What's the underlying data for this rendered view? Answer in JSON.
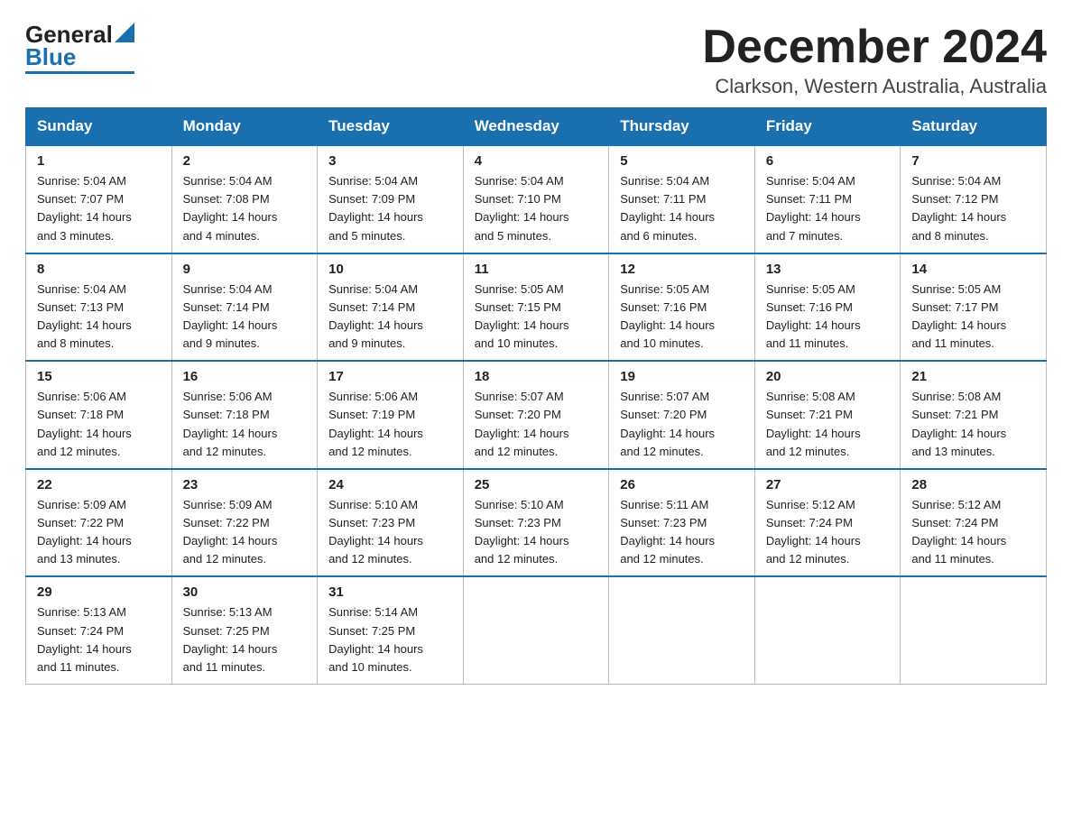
{
  "header": {
    "logo_general": "General",
    "logo_blue": "Blue",
    "month_title": "December 2024",
    "location": "Clarkson, Western Australia, Australia"
  },
  "days_of_week": [
    "Sunday",
    "Monday",
    "Tuesday",
    "Wednesday",
    "Thursday",
    "Friday",
    "Saturday"
  ],
  "weeks": [
    [
      {
        "day": "1",
        "sunrise": "5:04 AM",
        "sunset": "7:07 PM",
        "daylight": "14 hours and 3 minutes."
      },
      {
        "day": "2",
        "sunrise": "5:04 AM",
        "sunset": "7:08 PM",
        "daylight": "14 hours and 4 minutes."
      },
      {
        "day": "3",
        "sunrise": "5:04 AM",
        "sunset": "7:09 PM",
        "daylight": "14 hours and 5 minutes."
      },
      {
        "day": "4",
        "sunrise": "5:04 AM",
        "sunset": "7:10 PM",
        "daylight": "14 hours and 5 minutes."
      },
      {
        "day": "5",
        "sunrise": "5:04 AM",
        "sunset": "7:11 PM",
        "daylight": "14 hours and 6 minutes."
      },
      {
        "day": "6",
        "sunrise": "5:04 AM",
        "sunset": "7:11 PM",
        "daylight": "14 hours and 7 minutes."
      },
      {
        "day": "7",
        "sunrise": "5:04 AM",
        "sunset": "7:12 PM",
        "daylight": "14 hours and 8 minutes."
      }
    ],
    [
      {
        "day": "8",
        "sunrise": "5:04 AM",
        "sunset": "7:13 PM",
        "daylight": "14 hours and 8 minutes."
      },
      {
        "day": "9",
        "sunrise": "5:04 AM",
        "sunset": "7:14 PM",
        "daylight": "14 hours and 9 minutes."
      },
      {
        "day": "10",
        "sunrise": "5:04 AM",
        "sunset": "7:14 PM",
        "daylight": "14 hours and 9 minutes."
      },
      {
        "day": "11",
        "sunrise": "5:05 AM",
        "sunset": "7:15 PM",
        "daylight": "14 hours and 10 minutes."
      },
      {
        "day": "12",
        "sunrise": "5:05 AM",
        "sunset": "7:16 PM",
        "daylight": "14 hours and 10 minutes."
      },
      {
        "day": "13",
        "sunrise": "5:05 AM",
        "sunset": "7:16 PM",
        "daylight": "14 hours and 11 minutes."
      },
      {
        "day": "14",
        "sunrise": "5:05 AM",
        "sunset": "7:17 PM",
        "daylight": "14 hours and 11 minutes."
      }
    ],
    [
      {
        "day": "15",
        "sunrise": "5:06 AM",
        "sunset": "7:18 PM",
        "daylight": "14 hours and 12 minutes."
      },
      {
        "day": "16",
        "sunrise": "5:06 AM",
        "sunset": "7:18 PM",
        "daylight": "14 hours and 12 minutes."
      },
      {
        "day": "17",
        "sunrise": "5:06 AM",
        "sunset": "7:19 PM",
        "daylight": "14 hours and 12 minutes."
      },
      {
        "day": "18",
        "sunrise": "5:07 AM",
        "sunset": "7:20 PM",
        "daylight": "14 hours and 12 minutes."
      },
      {
        "day": "19",
        "sunrise": "5:07 AM",
        "sunset": "7:20 PM",
        "daylight": "14 hours and 12 minutes."
      },
      {
        "day": "20",
        "sunrise": "5:08 AM",
        "sunset": "7:21 PM",
        "daylight": "14 hours and 12 minutes."
      },
      {
        "day": "21",
        "sunrise": "5:08 AM",
        "sunset": "7:21 PM",
        "daylight": "14 hours and 13 minutes."
      }
    ],
    [
      {
        "day": "22",
        "sunrise": "5:09 AM",
        "sunset": "7:22 PM",
        "daylight": "14 hours and 13 minutes."
      },
      {
        "day": "23",
        "sunrise": "5:09 AM",
        "sunset": "7:22 PM",
        "daylight": "14 hours and 12 minutes."
      },
      {
        "day": "24",
        "sunrise": "5:10 AM",
        "sunset": "7:23 PM",
        "daylight": "14 hours and 12 minutes."
      },
      {
        "day": "25",
        "sunrise": "5:10 AM",
        "sunset": "7:23 PM",
        "daylight": "14 hours and 12 minutes."
      },
      {
        "day": "26",
        "sunrise": "5:11 AM",
        "sunset": "7:23 PM",
        "daylight": "14 hours and 12 minutes."
      },
      {
        "day": "27",
        "sunrise": "5:12 AM",
        "sunset": "7:24 PM",
        "daylight": "14 hours and 12 minutes."
      },
      {
        "day": "28",
        "sunrise": "5:12 AM",
        "sunset": "7:24 PM",
        "daylight": "14 hours and 11 minutes."
      }
    ],
    [
      {
        "day": "29",
        "sunrise": "5:13 AM",
        "sunset": "7:24 PM",
        "daylight": "14 hours and 11 minutes."
      },
      {
        "day": "30",
        "sunrise": "5:13 AM",
        "sunset": "7:25 PM",
        "daylight": "14 hours and 11 minutes."
      },
      {
        "day": "31",
        "sunrise": "5:14 AM",
        "sunset": "7:25 PM",
        "daylight": "14 hours and 10 minutes."
      },
      null,
      null,
      null,
      null
    ]
  ],
  "labels": {
    "sunrise": "Sunrise:",
    "sunset": "Sunset:",
    "daylight": "Daylight:"
  }
}
